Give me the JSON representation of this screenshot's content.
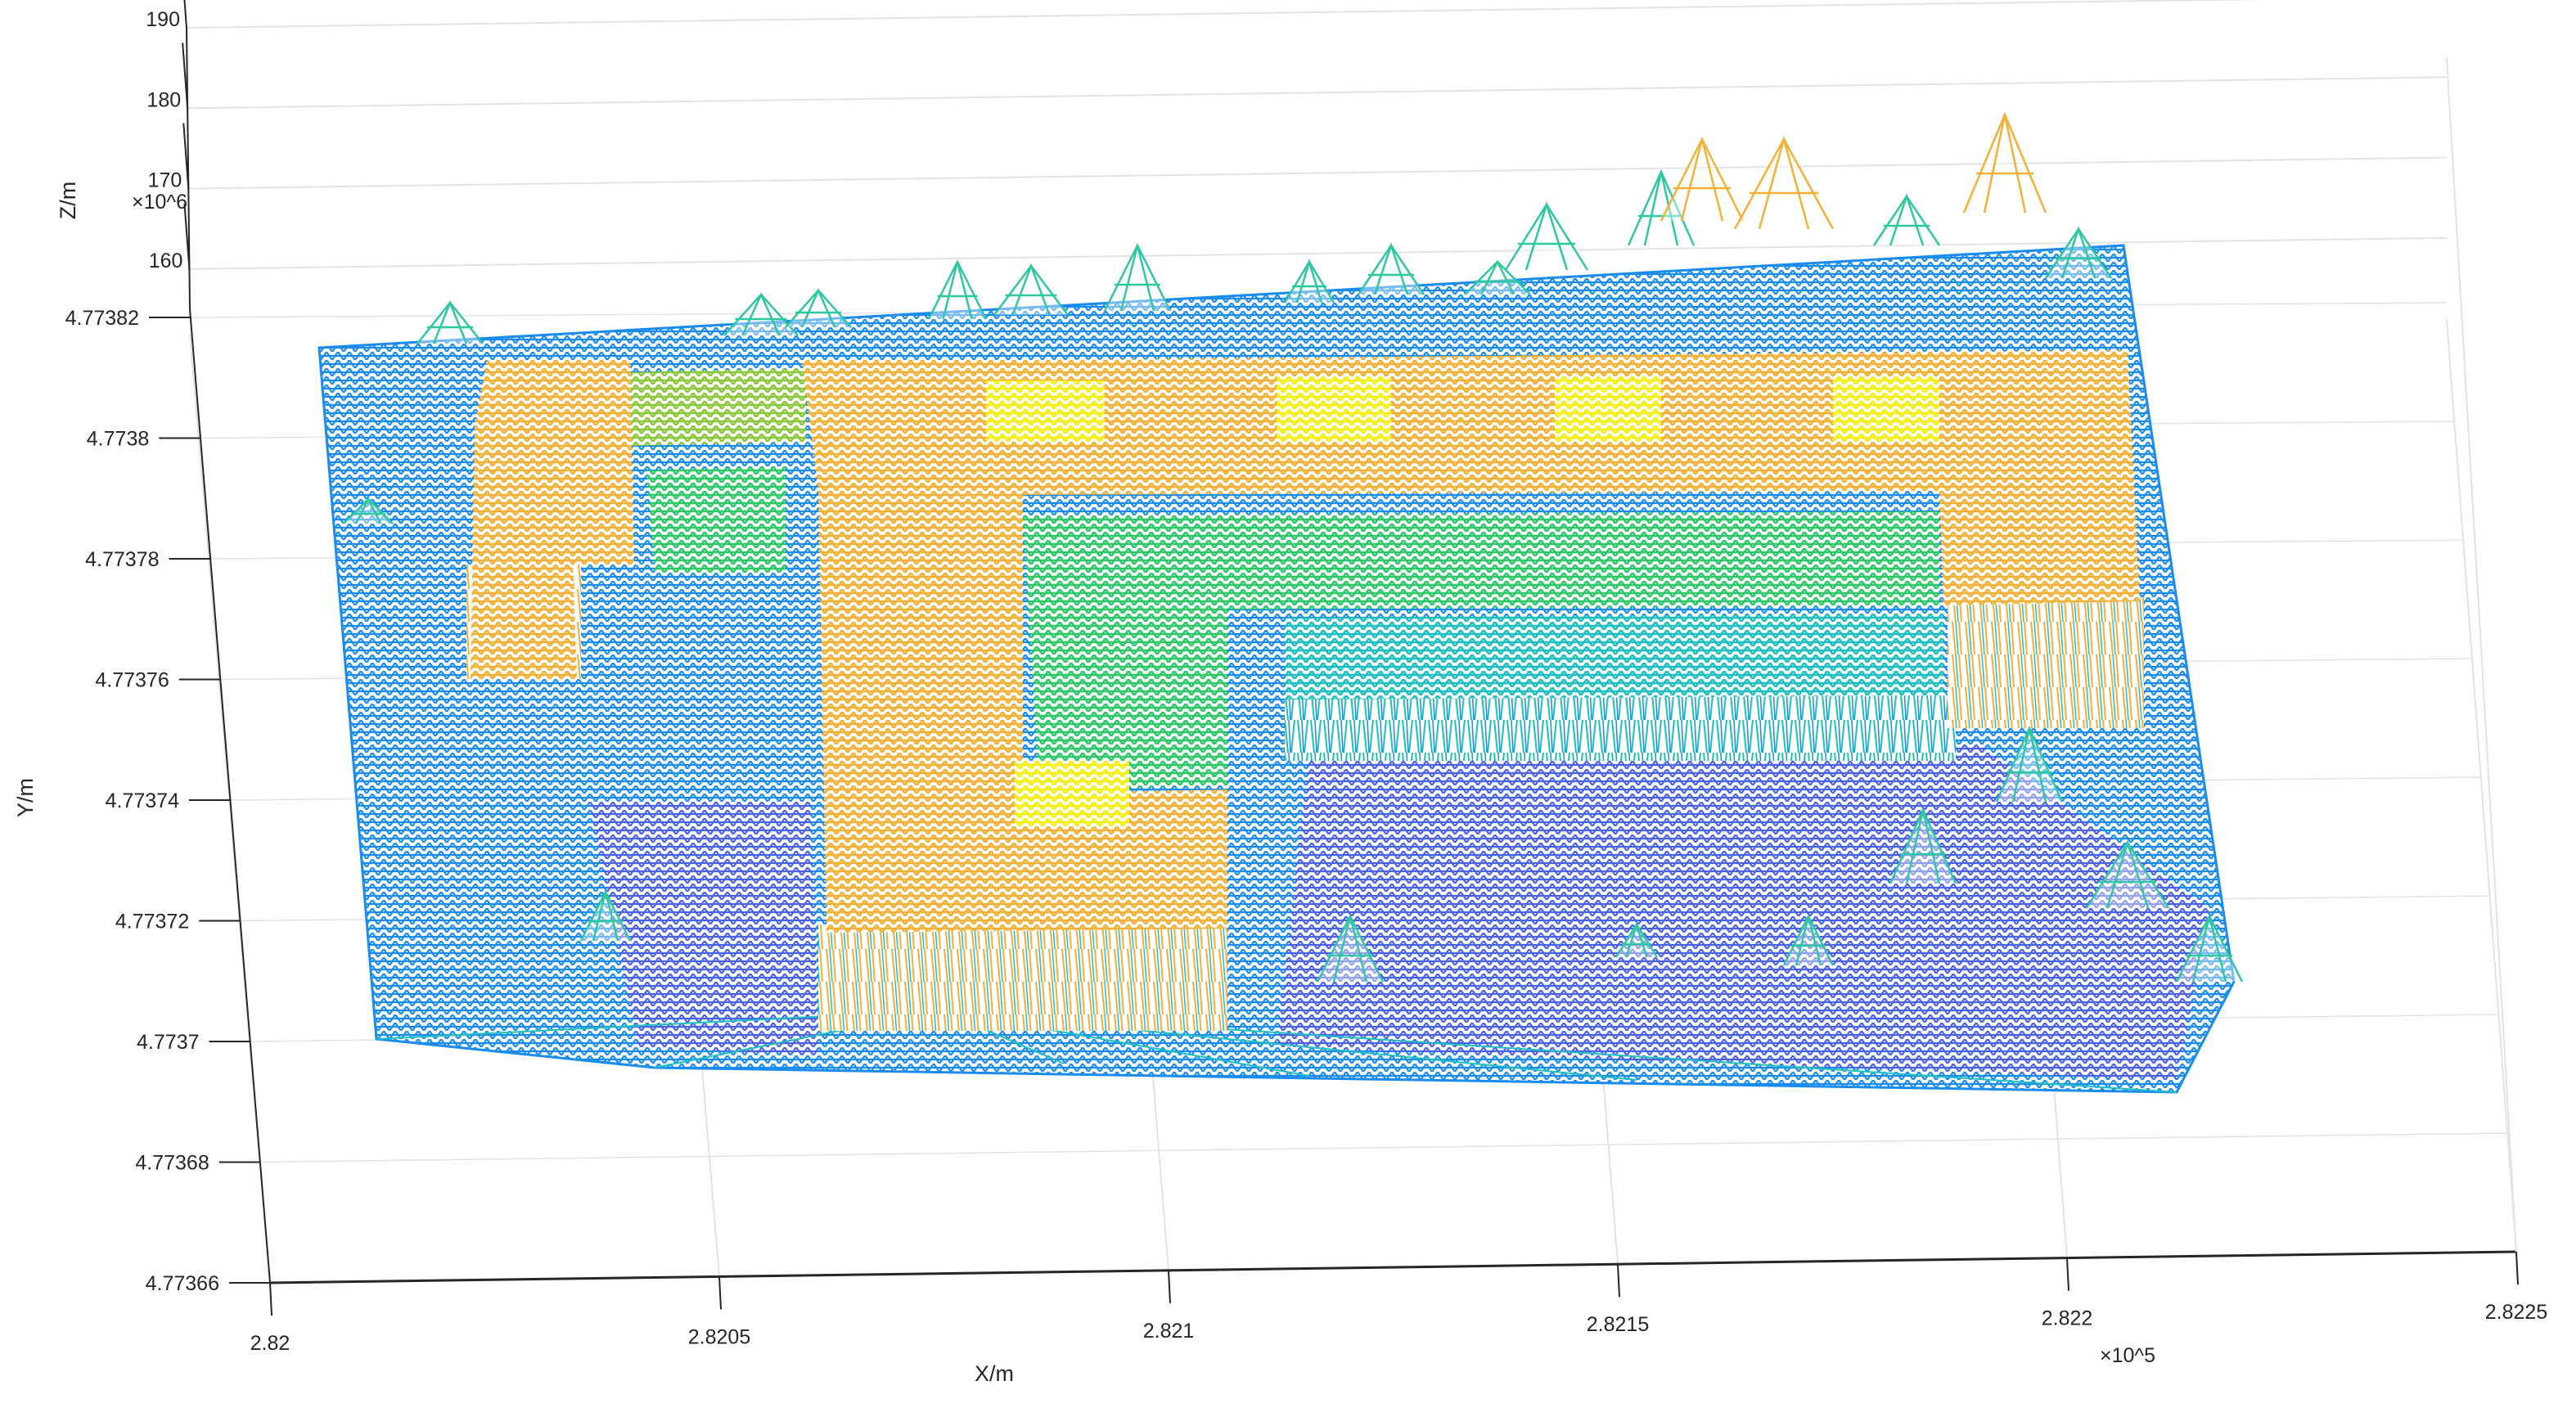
{
  "chart_data": {
    "type": "surface",
    "subtype": "3D triangulated mesh (building point cloud)",
    "xlabel": "X/m",
    "ylabel": "Y/m",
    "zlabel": "Z/m",
    "x_exponent_label": "×10^5",
    "y_exponent_label": "×10^6",
    "x_ticks": [
      "2.82",
      "2.8205",
      "2.821",
      "2.8215",
      "2.822",
      "2.8225"
    ],
    "x_tick_values": [
      2.82,
      2.8205,
      2.821,
      2.8215,
      2.822,
      2.8225
    ],
    "xlim": [
      2.82,
      2.8225
    ],
    "y_ticks": [
      "4.77382",
      "4.7738",
      "4.77378",
      "4.77376",
      "4.77374",
      "4.77372",
      "4.7737",
      "4.77368",
      "4.77366"
    ],
    "y_tick_values": [
      4.77382,
      4.7738,
      4.77378,
      4.77376,
      4.77374,
      4.77372,
      4.7737,
      4.77368,
      4.77366
    ],
    "ylim": [
      4.77366,
      4.77382
    ],
    "z_ticks": [
      "160",
      "170",
      "180",
      "190"
    ],
    "z_tick_values": [
      160,
      170,
      180,
      190
    ],
    "zlim": [
      155,
      190
    ],
    "grid": true,
    "colormap": "parula",
    "colors": {
      "ground": "#1a8cf0",
      "low": "#4a62e8",
      "teal": "#1fbfc0",
      "green": "#2ec868",
      "olive": "#8cc83c",
      "orange": "#f2b035",
      "yellow": "#f2ee10",
      "axis": "#262626",
      "grid": "#e3e3e3"
    }
  }
}
